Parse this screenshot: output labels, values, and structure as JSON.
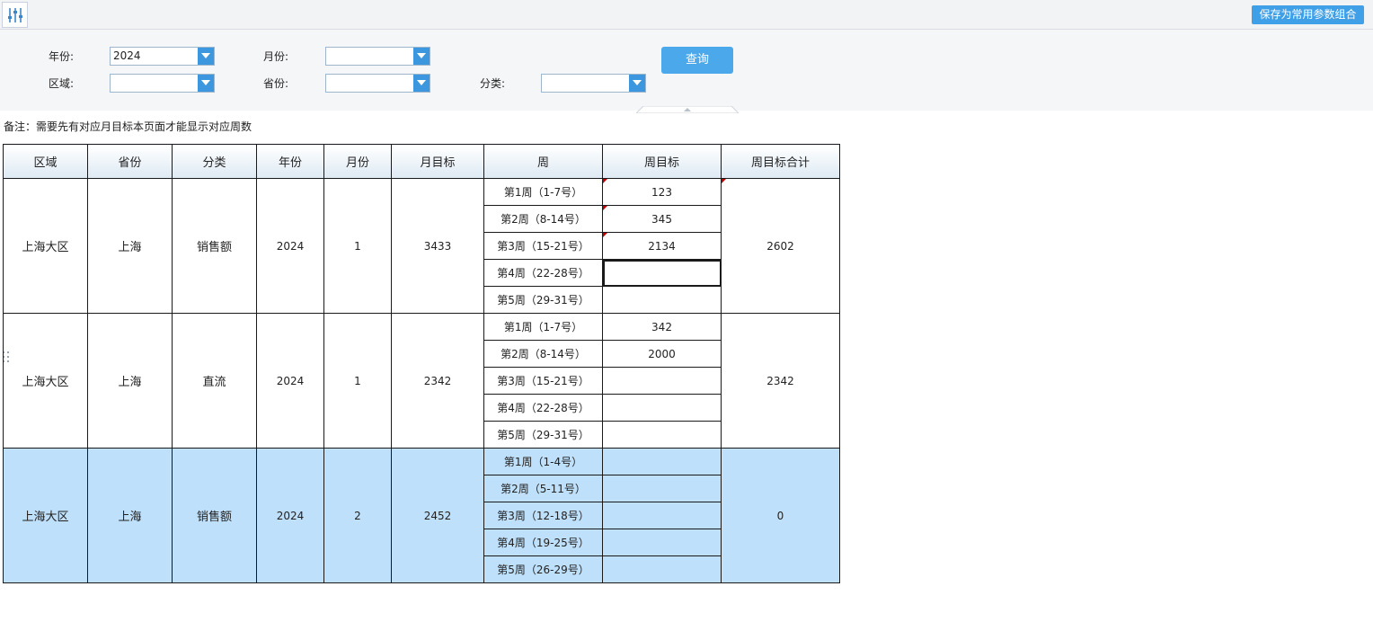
{
  "toolbar": {
    "param_icon": "sliders-icon",
    "save_label": "保存为常用参数组合"
  },
  "params": {
    "year": {
      "label": "年份:",
      "value": "2024"
    },
    "month": {
      "label": "月份:",
      "value": ""
    },
    "region": {
      "label": "区域:",
      "value": ""
    },
    "province": {
      "label": "省份:",
      "value": ""
    },
    "category": {
      "label": "分类:",
      "value": ""
    },
    "query_label": "查询",
    "dropdown_icon": "chevron-down-icon",
    "collapse_icon": "chevron-up-icon"
  },
  "remark": "备注：需要先有对应月目标本页面才能显示对应周数",
  "table": {
    "headers": [
      "区域",
      "省份",
      "分类",
      "年份",
      "月份",
      "月目标",
      "周",
      "周目标",
      "周目标合计"
    ],
    "groups": [
      {
        "region": "上海大区",
        "province": "上海",
        "category": "销售额",
        "year": "2024",
        "month": "1",
        "month_target": "3433",
        "total": "2602",
        "weeks": [
          {
            "week": "第1周（1-7号）",
            "target": "123",
            "flag": true
          },
          {
            "week": "第2周（8-14号）",
            "target": "345",
            "flag": true
          },
          {
            "week": "第3周（15-21号）",
            "target": "2134",
            "flag": true
          },
          {
            "week": "第4周（22-28号）",
            "target": "",
            "active": true
          },
          {
            "week": "第5周（29-31号）",
            "target": ""
          }
        ]
      },
      {
        "region": "上海大区",
        "province": "上海",
        "category": "直流",
        "year": "2024",
        "month": "1",
        "month_target": "2342",
        "total": "2342",
        "weeks": [
          {
            "week": "第1周（1-7号）",
            "target": "342"
          },
          {
            "week": "第2周（8-14号）",
            "target": "2000"
          },
          {
            "week": "第3周（15-21号）",
            "target": ""
          },
          {
            "week": "第4周（22-28号）",
            "target": ""
          },
          {
            "week": "第5周（29-31号）",
            "target": ""
          }
        ]
      },
      {
        "region": "上海大区",
        "province": "上海",
        "category": "销售额",
        "year": "2024",
        "month": "2",
        "month_target": "2452",
        "total": "0",
        "selected": true,
        "weeks": [
          {
            "week": "第1周（1-4号）",
            "target": ""
          },
          {
            "week": "第2周（5-11号）",
            "target": ""
          },
          {
            "week": "第3周（12-18号）",
            "target": ""
          },
          {
            "week": "第4周（19-25号）",
            "target": ""
          },
          {
            "week": "第5周（26-29号）",
            "target": ""
          }
        ]
      }
    ]
  },
  "colors": {
    "accent": "#3fa0e8",
    "selected_row": "#bfe0fb",
    "comment_flag": "#c00000"
  }
}
